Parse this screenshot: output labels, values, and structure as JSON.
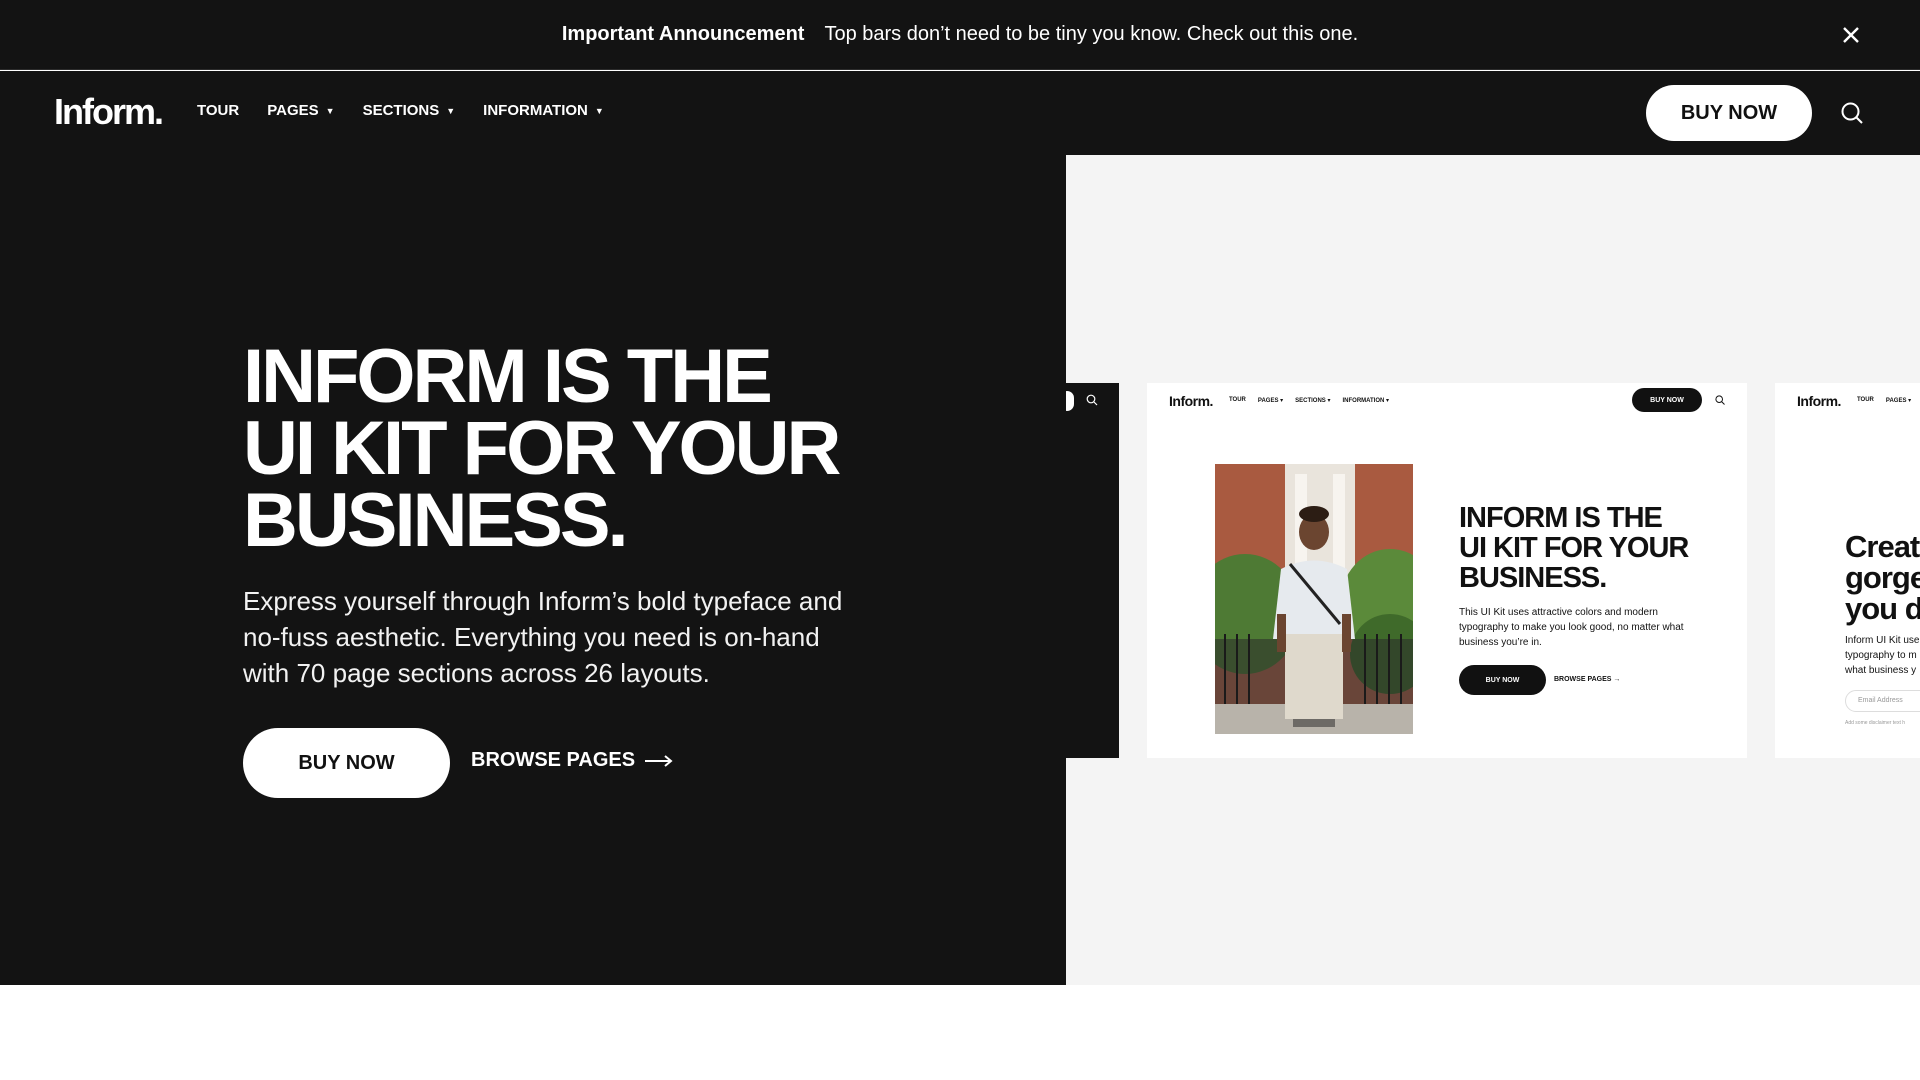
{
  "announcement": {
    "title": "Important Announcement",
    "message": "Top bars don’t need to be tiny you know. Check out this one."
  },
  "header": {
    "logo": "Inform.",
    "nav": [
      {
        "label": "TOUR",
        "has_dropdown": false
      },
      {
        "label": "PAGES",
        "has_dropdown": true
      },
      {
        "label": "SECTIONS",
        "has_dropdown": true
      },
      {
        "label": "INFORMATION",
        "has_dropdown": true
      }
    ],
    "buy_label": "BUY NOW"
  },
  "hero": {
    "title_lines": [
      "INFORM IS THE",
      "UI KIT FOR YOUR",
      "BUSINESS."
    ],
    "description": "Express yourself through Inform’s bold typeface and no-fuss aesthetic.  Everything you need is on-hand with 70 page sections across 26 layouts.",
    "buy_label": "BUY NOW",
    "browse_label": "BROWSE PAGES"
  },
  "preview": {
    "card1": {
      "logo": "Inform.",
      "nav": [
        "TOUR",
        "PAGES ▾",
        "SECTIONS ▾",
        "INFORMATION ▾"
      ],
      "buy_label": "BUY NOW",
      "title_lines": [
        "INFORM IS THE",
        "UI KIT FOR YOUR",
        "BUSINESS."
      ],
      "description": "This UI Kit uses attractive colors and modern typography to make you look good, no matter what business you’re in.",
      "button_label": "BUY NOW",
      "browse_label": "BROWSE PAGES →"
    },
    "card2": {
      "logo": "Inform.",
      "nav": [
        "TOUR",
        "PAGES ▾"
      ],
      "title_lines": [
        "Creat",
        "gorge",
        "you d"
      ],
      "desc_lines": [
        "Inform UI Kit use",
        "typography to m",
        "what business y"
      ],
      "input_placeholder": "Email Address",
      "note": "Add some disclaimer text h"
    }
  },
  "colors": {
    "dark": "#131313",
    "light_panel": "#f4f4f4",
    "white": "#ffffff"
  }
}
